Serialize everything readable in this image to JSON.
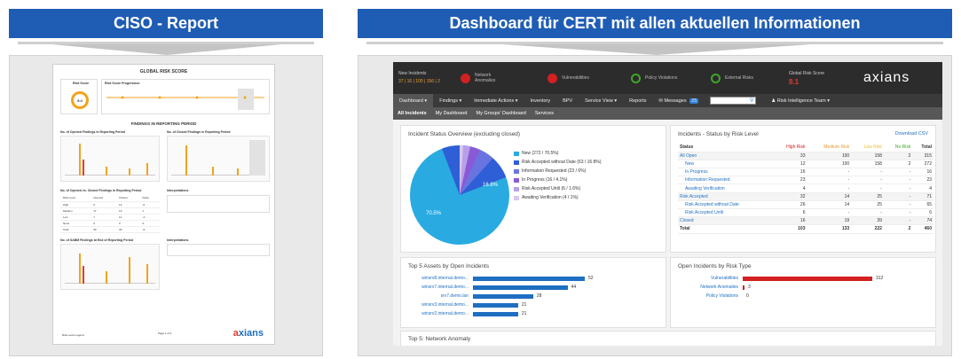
{
  "left": {
    "title": "CISO - Report",
    "report": {
      "title": "GLOBAL RISK SCORE",
      "risk_score_label": "Risk Score",
      "risk_score_value": "8.4",
      "risk_progression_label": "Risk Score Progression",
      "findings_title": "FINDINGS IN REPORTING PERIOD",
      "opened_label": "No. of Opened Findings in Reporting Period",
      "closed_label": "No. of Closed Findings in Reporting Period",
      "opened_closed_label": "No. of Opened vs. Closed Findings in Reporting Period",
      "interpretations_label": "Interpretations",
      "sabm_label": "No. of SABM Findings at End of Reporting Period",
      "interpretations2_label": "Interpretations",
      "table_rows": [
        {
          "risk": "High",
          "opened": "6",
          "closed": "12",
          "delta": "-6"
        },
        {
          "risk": "Medium",
          "opened": "17",
          "closed": "16",
          "delta": "1"
        },
        {
          "risk": "Low",
          "opened": "7",
          "closed": "11",
          "delta": "-4"
        },
        {
          "risk": "None",
          "opened": "0",
          "closed": "0",
          "delta": "0"
        },
        {
          "risk": "Total",
          "opened": "30",
          "closed": "39",
          "delta": "-9"
        }
      ],
      "table_header": [
        "Risk Level",
        "Opened",
        "Closed",
        "Delta"
      ],
      "legend": "Risk Level Legend",
      "page": "Page 1 of 4",
      "logo_main": "a",
      "logo_rest": "xians"
    }
  },
  "right": {
    "title": "Dashboard für CERT mit allen aktuellen Informationen",
    "topbar": {
      "new_incidents_label": "New Incidents",
      "new_incidents_values": "37 | 16 | 100 | 156 | 2",
      "indicators": [
        {
          "label": "Network Anomalies",
          "color": "#d32020"
        },
        {
          "label": "Vulnerabilities",
          "color": "#d32020"
        },
        {
          "label": "Policy Violations",
          "color": "#3fa52a"
        },
        {
          "label": "External Risks",
          "color": "#3fa52a"
        }
      ],
      "global_risk_label": "Global Risk Score",
      "global_risk_value": "8.1",
      "logo_main": "a",
      "logo_rest": "xians"
    },
    "nav": [
      "Dashboard ▾",
      "Findings ▾",
      "Immediate Actions ▾",
      "Inventory",
      "BPV",
      "Service View ▾",
      "Reports",
      "Messages",
      "Risk Intelligence Team ▾"
    ],
    "messages_badge": "25",
    "subnav": [
      "All Incidents",
      "My Dashboard",
      "My Groups' Dashboard",
      "Services"
    ],
    "status_overview": {
      "title": "Incident Status Overview (excluding closed)",
      "legend": [
        {
          "label": "New (272 / 70.5%)",
          "color": "#29abe2"
        },
        {
          "label": "Risk Accepted without Date (63 / 16.8%)",
          "color": "#2e5fd6"
        },
        {
          "label": "Information Requested (23 / 6%)",
          "color": "#6a74e0"
        },
        {
          "label": "In Progress (16 / 4.1%)",
          "color": "#8a5ad6"
        },
        {
          "label": "Risk Accepted Until (6 / 1.6%)",
          "color": "#b8a0e8"
        },
        {
          "label": "Awaiting Verification (4 / 1%)",
          "color": "#d8c8f0"
        }
      ],
      "slice_label_big": "70.5%",
      "slice_label_small": "16.8%"
    },
    "risk_level": {
      "title": "Incidents - Status by Risk Level",
      "download": "Download CSV",
      "headers": [
        "Status",
        "High Risk",
        "Medium Risk",
        "Low Risk",
        "No Risk",
        "Total"
      ],
      "rows": [
        {
          "status": "All Open",
          "v": [
            "33",
            "100",
            "158",
            "2",
            "315"
          ]
        },
        {
          "status": "New",
          "v": [
            "12",
            "100",
            "158",
            "2",
            "272"
          ]
        },
        {
          "status": "In Progress",
          "v": [
            "16",
            "-",
            "-",
            "-",
            "16"
          ]
        },
        {
          "status": "Information Requested",
          "v": [
            "23",
            "-",
            "-",
            "-",
            "23"
          ]
        },
        {
          "status": "Awaiting Verification",
          "v": [
            "4",
            "-",
            "-",
            "-",
            "4"
          ]
        },
        {
          "status": "Risk Accepted",
          "v": [
            "32",
            "14",
            "25",
            "-",
            "71"
          ]
        },
        {
          "status": "Risk Accepted without Date",
          "v": [
            "26",
            "14",
            "25",
            "-",
            "65"
          ]
        },
        {
          "status": "Risk Accepted Until",
          "v": [
            "6",
            "-",
            "-",
            "-",
            "6"
          ]
        },
        {
          "status": "Closed",
          "v": [
            "16",
            "19",
            "39",
            "-",
            "74"
          ]
        },
        {
          "status": "Total",
          "v": [
            "103",
            "133",
            "222",
            "2",
            "460"
          ]
        }
      ]
    },
    "top_assets": {
      "title": "Top 5 Assets by Open Incidents",
      "rows": [
        {
          "label": "winsrv8.internal.demo...",
          "value": 52
        },
        {
          "label": "winsrv7.internal.demo...",
          "value": 44
        },
        {
          "label": "srv7.demo.lan",
          "value": 28
        },
        {
          "label": "winsrv3.internal.demo...",
          "value": 21
        },
        {
          "label": "winsrv2.internal.demo...",
          "value": 21
        }
      ]
    },
    "risk_type": {
      "title": "Open Incidents by Risk Type",
      "rows": [
        {
          "label": "Vulnerabilities",
          "value": 312,
          "color": "#d32020"
        },
        {
          "label": "Network Anomalies",
          "value": 3,
          "color": "#d32020"
        },
        {
          "label": "Policy Violations",
          "value": 0,
          "color": "#d32020"
        }
      ]
    },
    "network_anomaly": {
      "title": "Top 5: Network Anomaly"
    }
  }
}
